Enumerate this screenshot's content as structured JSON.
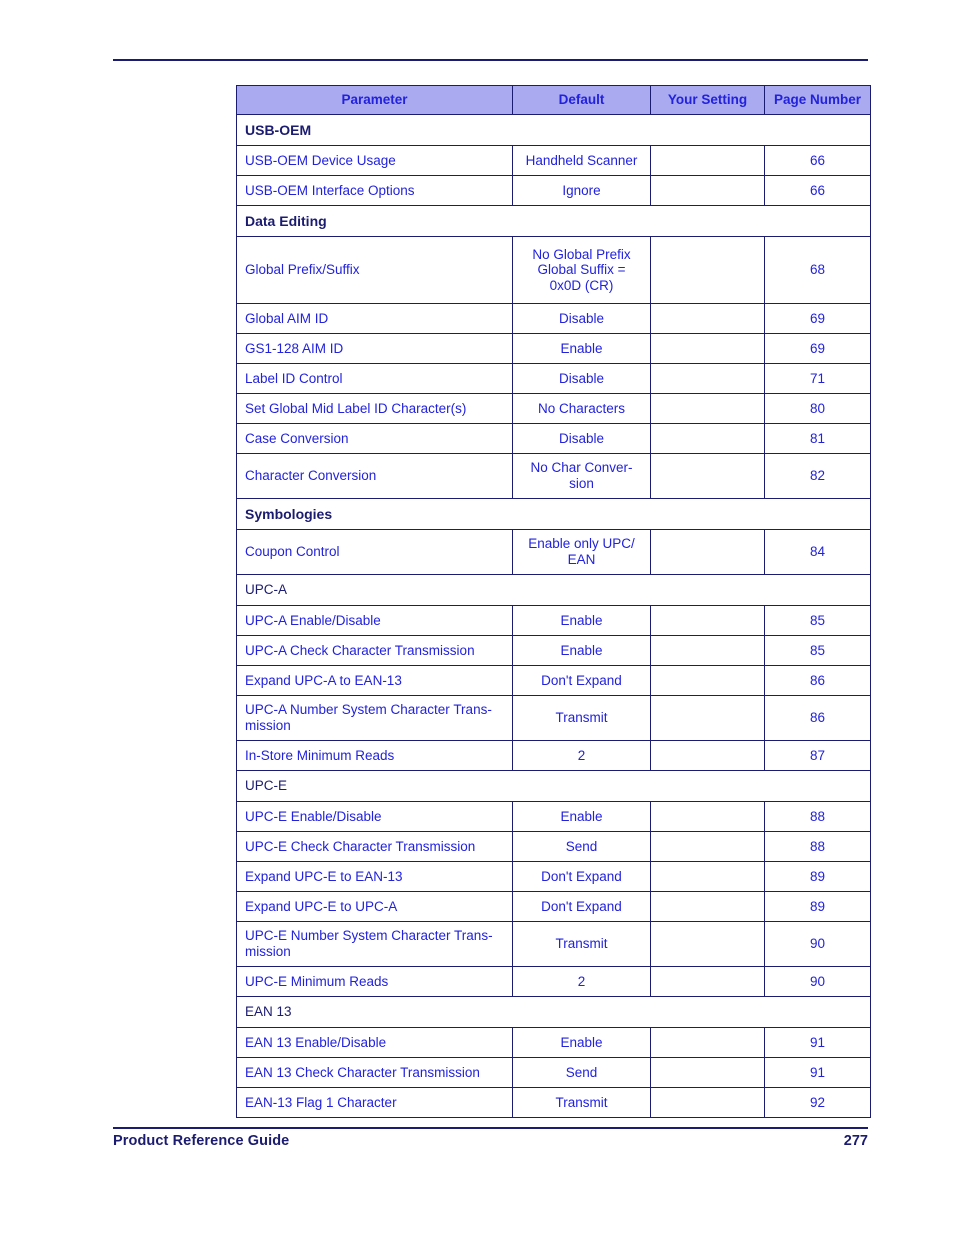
{
  "document": {
    "footer_title": "Product Reference Guide",
    "footer_page": "277"
  },
  "colors": {
    "header_fill": "#aaaaf0",
    "border": "#1b1b6f",
    "link_text": "#2222dd",
    "dark_text": "#1b1b6f",
    "page_background": "#ffffff"
  },
  "table": {
    "columns": [
      {
        "label": "Parameter"
      },
      {
        "label": "Default"
      },
      {
        "label": "Your Setting"
      },
      {
        "label": "Page Number"
      }
    ],
    "rows": [
      {
        "kind": "section",
        "bold": true,
        "label": "USB-OEM"
      },
      {
        "kind": "data",
        "parameter": "USB-OEM Device Usage",
        "default": "Handheld Scanner",
        "setting": "",
        "page": "66"
      },
      {
        "kind": "data",
        "parameter": "USB-OEM Interface Options",
        "default": "Ignore",
        "setting": "",
        "page": "66"
      },
      {
        "kind": "section",
        "bold": true,
        "label": "Data Editing"
      },
      {
        "kind": "data",
        "size": "tall",
        "parameter": "Global Prefix/Suffix",
        "default": "No Global Prefix Global Suffix = 0x0D (CR)",
        "setting": "",
        "page": "68"
      },
      {
        "kind": "data",
        "parameter": "Global AIM ID",
        "default": "Disable",
        "setting": "",
        "page": "69"
      },
      {
        "kind": "data",
        "parameter": "GS1-128 AIM ID",
        "default": "Enable",
        "setting": "",
        "page": "69"
      },
      {
        "kind": "data",
        "parameter": "Label ID Control",
        "default": "Disable",
        "setting": "",
        "page": "71"
      },
      {
        "kind": "data",
        "parameter": "Set Global Mid Label ID Character(s)",
        "default": "No Characters",
        "setting": "",
        "page": "80"
      },
      {
        "kind": "data",
        "parameter": "Case Conversion",
        "default": "Disable",
        "setting": "",
        "page": "81"
      },
      {
        "kind": "data",
        "size": "tall2",
        "parameter": "Character Conversion",
        "default": "No Char Conver-sion",
        "setting": "",
        "page": "82"
      },
      {
        "kind": "section",
        "bold": true,
        "label": "Symbologies"
      },
      {
        "kind": "data",
        "size": "tall2",
        "parameter": "Coupon Control",
        "default": "Enable only UPC/ EAN",
        "setting": "",
        "page": "84"
      },
      {
        "kind": "section",
        "bold": false,
        "label": "UPC-A"
      },
      {
        "kind": "data",
        "parameter": "UPC-A Enable/Disable",
        "default": "Enable",
        "setting": "",
        "page": "85"
      },
      {
        "kind": "data",
        "parameter": "UPC-A Check Character Transmission",
        "default": "Enable",
        "setting": "",
        "page": "85"
      },
      {
        "kind": "data",
        "parameter": "Expand UPC-A to EAN-13",
        "default": "Don't Expand",
        "setting": "",
        "page": "86"
      },
      {
        "kind": "data",
        "size": "tall2",
        "parameter": "UPC-A Number System Character Trans-mission",
        "default": "Transmit",
        "setting": "",
        "page": "86"
      },
      {
        "kind": "data",
        "parameter": "In-Store Minimum Reads",
        "default": "2",
        "setting": "",
        "page": "87"
      },
      {
        "kind": "section",
        "bold": false,
        "label": "UPC-E"
      },
      {
        "kind": "data",
        "parameter": "UPC-E Enable/Disable",
        "default": "Enable",
        "setting": "",
        "page": "88"
      },
      {
        "kind": "data",
        "parameter": "UPC-E Check Character Transmission",
        "default": "Send",
        "setting": "",
        "page": "88"
      },
      {
        "kind": "data",
        "parameter": "Expand UPC-E to EAN-13",
        "default": "Don't Expand",
        "setting": "",
        "page": "89"
      },
      {
        "kind": "data",
        "parameter": "Expand UPC-E to UPC-A",
        "default": "Don't Expand",
        "setting": "",
        "page": "89"
      },
      {
        "kind": "data",
        "size": "tall2",
        "parameter": "UPC-E Number System Character Trans-mission",
        "default": "Transmit",
        "setting": "",
        "page": "90"
      },
      {
        "kind": "data",
        "parameter": "UPC-E Minimum Reads",
        "default": "2",
        "setting": "",
        "page": "90"
      },
      {
        "kind": "section",
        "bold": false,
        "label": "EAN 13"
      },
      {
        "kind": "data",
        "parameter": "EAN 13 Enable/Disable",
        "default": "Enable",
        "setting": "",
        "page": "91"
      },
      {
        "kind": "data",
        "parameter": "EAN 13 Check Character Transmission",
        "default": "Send",
        "setting": "",
        "page": "91"
      },
      {
        "kind": "data",
        "parameter": "EAN-13 Flag 1 Character",
        "default": "Transmit",
        "setting": "",
        "page": "92"
      }
    ]
  }
}
